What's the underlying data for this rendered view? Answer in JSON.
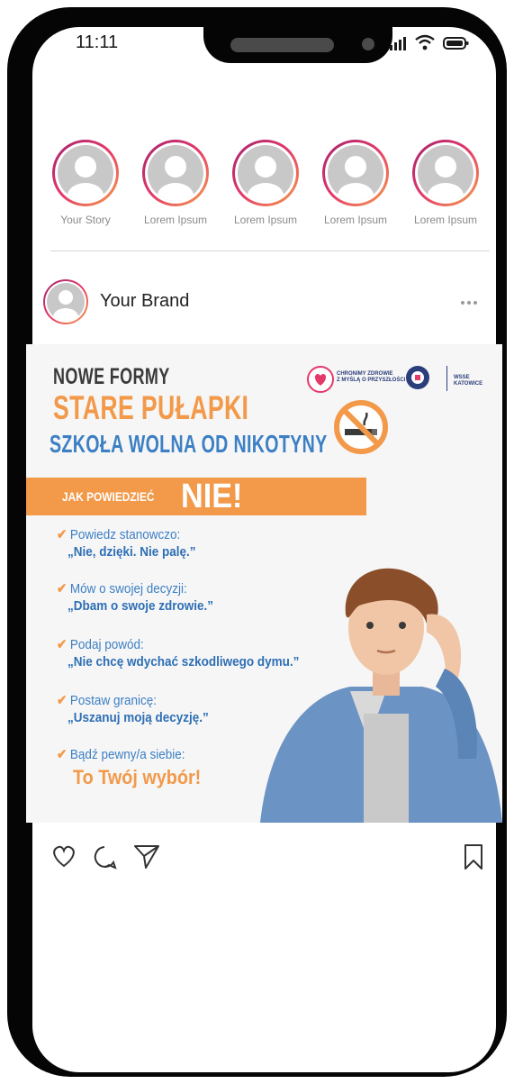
{
  "status_bar": {
    "time": "11:11",
    "icons": [
      "signal-icon",
      "wifi-icon",
      "battery-icon"
    ]
  },
  "stories": [
    {
      "label": "Your Story"
    },
    {
      "label": "Lorem Ipsum"
    },
    {
      "label": "Lorem Ipsum"
    },
    {
      "label": "Lorem Ipsum"
    },
    {
      "label": "Lorem Ipsum"
    }
  ],
  "post": {
    "brand_name": "Your Brand",
    "image": {
      "title_line1": "NOWE FORMY",
      "title_line2": "STARE PUŁAPKI",
      "title_line3": "SZKOŁA WOLNA OD NIKOTYNY",
      "logo_text": "CHRONIMY ZDROWIE\nZ MYŚLĄ O PRZYSZŁOŚCI",
      "logo_org": "WSSE KATOWICE",
      "banner_small": "JAK POWIEDZIEĆ",
      "banner_big": "NIE!",
      "tips": [
        {
          "heading": "Powiedz stanowczo:",
          "quote": "„Nie, dzięki. Nie palę.”"
        },
        {
          "heading": "Mów o swojej decyzji:",
          "quote": "„Dbam o swoje zdrowie.”"
        },
        {
          "heading": "Podaj powód:",
          "quote": "„Nie chcę wdychać szkodliwego dymu.”"
        },
        {
          "heading": "Postaw granicę:",
          "quote": "„Uszanuj moją decyzję.”"
        },
        {
          "heading": "Bądź pewny/a siebie:",
          "quote": "To Twój wybór!"
        }
      ]
    },
    "actions": [
      "heart-icon",
      "comment-icon",
      "share-icon",
      "bookmark-icon"
    ]
  },
  "colors": {
    "accent_orange": "#f2994a",
    "accent_blue": "#3c7fc4",
    "story_ring_start": "#a1236e",
    "story_ring_end": "#f4a24a"
  }
}
